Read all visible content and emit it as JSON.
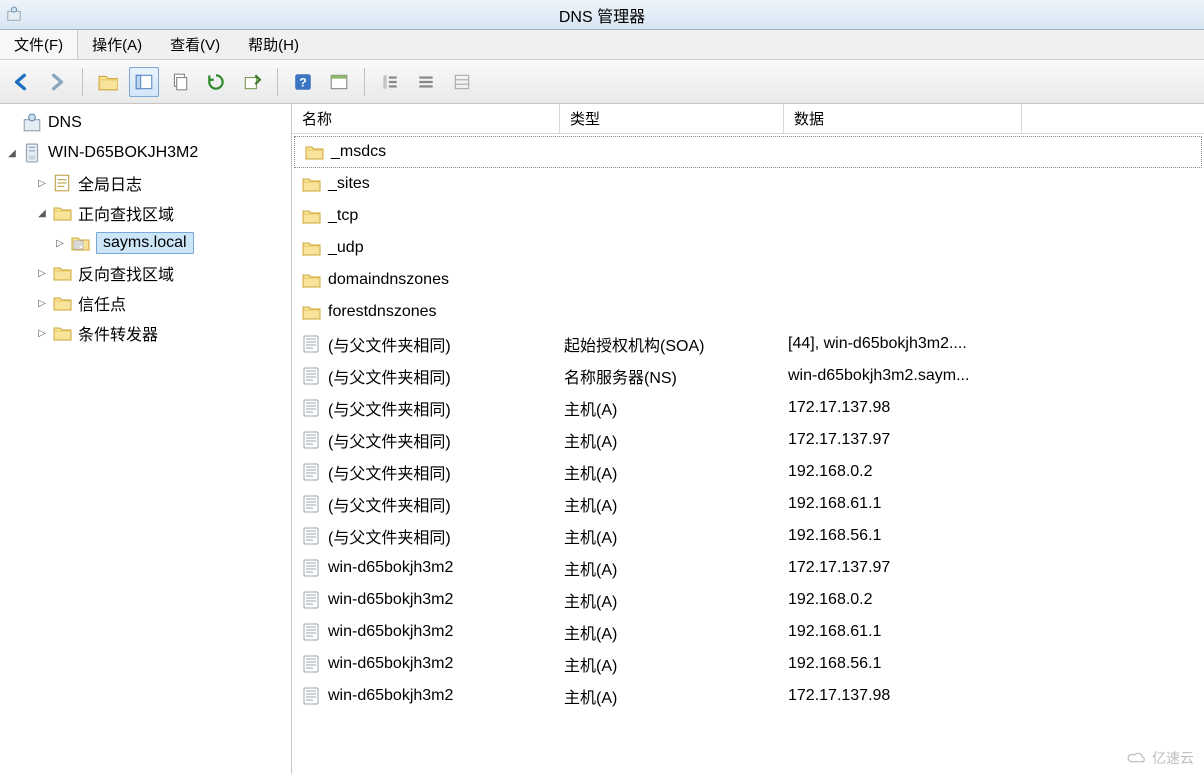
{
  "title": "DNS 管理器",
  "menu": {
    "file": "文件(F)",
    "action": "操作(A)",
    "view": "查看(V)",
    "help": "帮助(H)"
  },
  "tree": {
    "root": "DNS",
    "server": "WIN-D65BOKJH3M2",
    "global_log": "全局日志",
    "forward_zones": "正向查找区域",
    "zone_sayms": "sayms.local",
    "reverse_zones": "反向查找区域",
    "trust_points": "信任点",
    "conditional_forwarders": "条件转发器"
  },
  "columns": {
    "name": "名称",
    "type": "类型",
    "data": "数据"
  },
  "rows": [
    {
      "icon": "folder",
      "name": "_msdcs",
      "type": "",
      "data": "",
      "focused": true
    },
    {
      "icon": "folder",
      "name": "_sites",
      "type": "",
      "data": ""
    },
    {
      "icon": "folder",
      "name": "_tcp",
      "type": "",
      "data": ""
    },
    {
      "icon": "folder",
      "name": "_udp",
      "type": "",
      "data": ""
    },
    {
      "icon": "folder",
      "name": "domaindnszones",
      "type": "",
      "data": ""
    },
    {
      "icon": "folder",
      "name": "forestdnszones",
      "type": "",
      "data": ""
    },
    {
      "icon": "record",
      "name": "(与父文件夹相同)",
      "type": "起始授权机构(SOA)",
      "data": "[44], win-d65bokjh3m2...."
    },
    {
      "icon": "record",
      "name": "(与父文件夹相同)",
      "type": "名称服务器(NS)",
      "data": "win-d65bokjh3m2.saym..."
    },
    {
      "icon": "record",
      "name": "(与父文件夹相同)",
      "type": "主机(A)",
      "data": "172.17.137.98"
    },
    {
      "icon": "record",
      "name": "(与父文件夹相同)",
      "type": "主机(A)",
      "data": "172.17.137.97"
    },
    {
      "icon": "record",
      "name": "(与父文件夹相同)",
      "type": "主机(A)",
      "data": "192.168.0.2"
    },
    {
      "icon": "record",
      "name": "(与父文件夹相同)",
      "type": "主机(A)",
      "data": "192.168.61.1"
    },
    {
      "icon": "record",
      "name": "(与父文件夹相同)",
      "type": "主机(A)",
      "data": "192.168.56.1"
    },
    {
      "icon": "record",
      "name": "win-d65bokjh3m2",
      "type": "主机(A)",
      "data": "172.17.137.97"
    },
    {
      "icon": "record",
      "name": "win-d65bokjh3m2",
      "type": "主机(A)",
      "data": "192.168.0.2"
    },
    {
      "icon": "record",
      "name": "win-d65bokjh3m2",
      "type": "主机(A)",
      "data": "192.168.61.1"
    },
    {
      "icon": "record",
      "name": "win-d65bokjh3m2",
      "type": "主机(A)",
      "data": "192.168.56.1"
    },
    {
      "icon": "record",
      "name": "win-d65bokjh3m2",
      "type": "主机(A)",
      "data": "172.17.137.98"
    }
  ],
  "watermark": "亿速云"
}
